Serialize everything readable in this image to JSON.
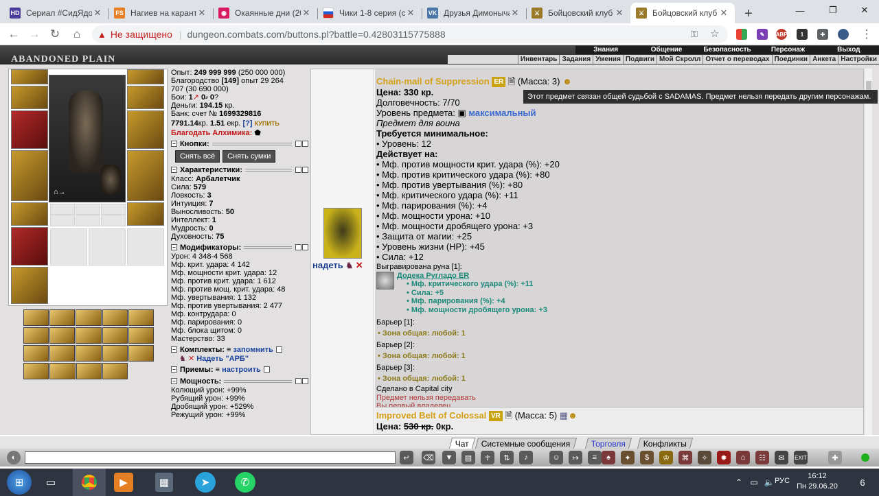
{
  "browser": {
    "tabs": [
      {
        "title": "Сериал #СидЯдо…",
        "icon_text": "HD",
        "icon_color": "#4a3a9a"
      },
      {
        "title": "Нагиев на каранти…",
        "icon_text": "FS",
        "icon_color": "#e67e22"
      },
      {
        "title": "Окаянные дни (20…",
        "icon_text": "◉",
        "icon_color": "#d81b60"
      },
      {
        "title": "Чики 1-8 серия (с…",
        "icon_text": "",
        "icon_color": "#1e5bd6"
      },
      {
        "title": "Друзья Димоныча…",
        "icon_text": "VK",
        "icon_color": "#4a76a8"
      },
      {
        "title": "Бойцовский клуб…",
        "icon_text": "⚔",
        "icon_color": "#9a7a2a"
      },
      {
        "title": "Бойцовский клуб",
        "icon_text": "⚔",
        "icon_color": "#9a7a2a"
      }
    ],
    "new_tab": "+",
    "not_secure": "Не защищено",
    "url": "dungeon.combats.com/buttons.pl?battle=0.42803115775888",
    "ext_badge": "1"
  },
  "game": {
    "logo": "ABANDONED PLAIN",
    "top_menu": [
      "Знания",
      "Общение",
      "Безопасность",
      "Персонаж",
      "Выход"
    ],
    "sub_menu": [
      "Инвентарь",
      "Задания",
      "Умения",
      "Подвиги",
      "Мой Скролл",
      "Отчет о переводах",
      "Поединки",
      "Анкета",
      "Настройки"
    ]
  },
  "character": {
    "exp_label": "Опыт:",
    "exp_value": "249 999 999",
    "exp_next": "(250 000 000)",
    "valor_label": "Благородство",
    "valor_level": "[149]",
    "valor_rest": "опыт 29 264",
    "valor_line2": "707 (30 690 000)",
    "fights_label": "Бои:",
    "fights_win": "1",
    "fights_loss": "0",
    "fights_draw": "0",
    "money_label": "Деньги:",
    "money_value": "194.15",
    "money_unit": "кр.",
    "bank_label": "Банк: счет №",
    "bank_account": "1699329816",
    "bank_kr": "7791.14",
    "bank_kr_unit": "кр.",
    "bank_ekr": "1.51",
    "bank_ekr_unit": "екр.",
    "bank_help": "[?]",
    "buy_label": "КУПИТЬ",
    "alchemist_label": "Благодать Алхимика:",
    "buttons_title": "Кнопки:",
    "btn_remove_all": "Снять всё",
    "btn_remove_bags": "Снять сумки",
    "stats_title": "Характеристики:",
    "stats": [
      {
        "label": "Класс:",
        "value": "Арбалетчик"
      },
      {
        "label": "Сила:",
        "value": "579"
      },
      {
        "label": "Ловкость:",
        "value": "3"
      },
      {
        "label": "Интуиция:",
        "value": "7"
      },
      {
        "label": "Выносливость:",
        "value": "50"
      },
      {
        "label": "Интеллект:",
        "value": "1"
      },
      {
        "label": "Мудрость:",
        "value": "0"
      },
      {
        "label": "Духовность:",
        "value": "75"
      }
    ],
    "mods_title": "Модификаторы:",
    "mods": [
      "Урон: 4 348-4 568",
      "Мф. крит. удара: 4 142",
      "Мф. мощности крит. удара: 12",
      "Мф. против крит. удара: 1 612",
      "Мф. против мощ. крит. удара: 48",
      "Мф. увертывания: 1 132",
      "Мф. против увертывания: 2 477",
      "Мф. контрудара: 0",
      "Мф. парирования: 0",
      "Мф. блока щитом: 0",
      "Мастерство: 33"
    ],
    "sets_title": "Комплекты:",
    "sets_remember": "запомнить",
    "set_wear": "Надеть \"АРБ\"",
    "tricks_title": "Приемы:",
    "tricks_setup": "настроить",
    "power_title": "Мощность:",
    "power": [
      "Колющий урон: +99%",
      "Рубящий урон: +99%",
      "Дробящий урон: +529%",
      "Режущий урон: +99%"
    ],
    "avatar_caption": "⌂→"
  },
  "item": {
    "wear_label": "надеть",
    "name": "Chain-mail of Suppression",
    "badge": "ER",
    "mass": "(Масса: 3)",
    "price_label": "Цена:",
    "price": "330 кр.",
    "durability": "Долговечность: 7/70",
    "level_label": "Уровень предмета:",
    "level_value": "максимальный",
    "for_class": "Предмет для воина",
    "req_title": "Требуется минимальное:",
    "req": [
      "• Уровень: 12"
    ],
    "acts_title": "Действует на:",
    "acts": [
      "• Мф. против мощности крит. удара (%): +20",
      "• Мф. против критического удара (%): +80",
      "• Мф. против увертывания (%): +80",
      "• Мф. критического удара (%): +11",
      "• Мф. парирования (%): +4",
      "• Мф. мощности урона: +10",
      "• Мф. мощности дробящего урона: +3",
      "• Защита от магии: +25",
      "• Уровень жизни (HP): +45",
      "• Сила: +12"
    ],
    "rune_title": "Выгравирована руна [1]:",
    "rune_name": "Додека Ругладо ER",
    "rune_effects": [
      "• Мф. критического удара (%): +11",
      "• Сила: +5",
      "• Мф. парирования (%): +4",
      "• Мф. мощности дробящего урона: +3"
    ],
    "barriers": [
      {
        "title": "Барьер [1]:",
        "zone": "• Зона общая: любой: 1"
      },
      {
        "title": "Барьер [2]:",
        "zone": "• Зона общая: любой: 1"
      },
      {
        "title": "Барьер [3]:",
        "zone": "• Зона общая: любой: 1"
      }
    ],
    "made_in": "Сделано в Capital city",
    "no_transfer": "Предмет нельзя передавать",
    "first_owner": "Вы первый владелец",
    "tooltip": "Этот предмет связан общей судьбой с SADAMAS. Предмет нельзя передать другим персонажам."
  },
  "item2": {
    "name": "Improved Belt of Colossal",
    "badge": "VR",
    "mass": "(Масса: 5)",
    "price_label": "Цена:",
    "price_old": "530 кр.",
    "price_new": "0кр."
  },
  "chat": {
    "tabs": [
      "Чат",
      "Системные сообщения",
      "Торговля",
      "Конфликты"
    ]
  },
  "taskbar": {
    "lang": "РУС",
    "time": "16:12",
    "date": "Пн 29.06.20",
    "notif": "6"
  }
}
